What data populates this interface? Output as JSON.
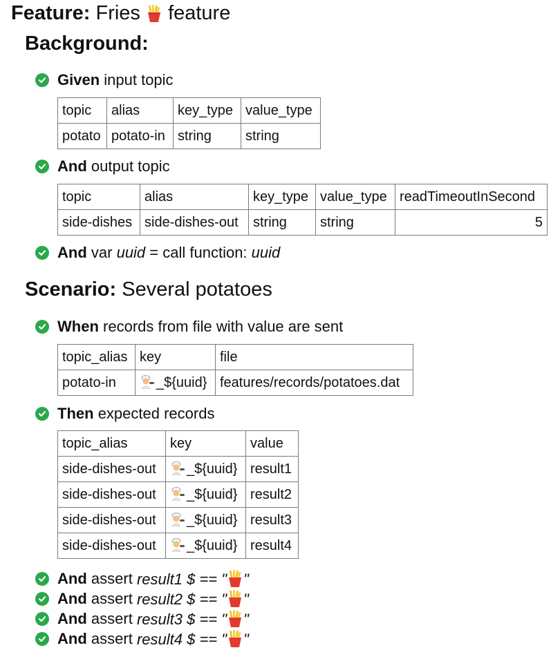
{
  "feature": {
    "keyword": "Feature:",
    "name_before": "Fries",
    "name_after": "feature"
  },
  "background": {
    "keyword": "Background:",
    "steps": [
      {
        "keyword": "Given",
        "text": "input topic",
        "table": {
          "headers": [
            "topic",
            "alias",
            "key_type",
            "value_type"
          ],
          "rows": [
            [
              "potato",
              "potato-in",
              "string",
              "string"
            ]
          ]
        }
      },
      {
        "keyword": "And",
        "text": "output topic",
        "table": {
          "headers": [
            "topic",
            "alias",
            "key_type",
            "value_type",
            "readTimeoutInSecond"
          ],
          "rows": [
            [
              "side-dishes",
              "side-dishes-out",
              "string",
              "string",
              "5"
            ]
          ]
        }
      },
      {
        "keyword": "And",
        "pre": "var",
        "var": "uuid",
        "mid": "= call function:",
        "fn": "uuid"
      }
    ]
  },
  "scenario": {
    "keyword": "Scenario:",
    "name": "Several potatoes",
    "steps": [
      {
        "keyword": "When",
        "text": "records from file with value are sent",
        "table": {
          "headers": [
            "topic_alias",
            "key",
            "file"
          ],
          "rows": [
            [
              "potato-in",
              "_${uuid}",
              "features/records/potatoes.dat"
            ]
          ]
        }
      },
      {
        "keyword": "Then",
        "text": "expected records",
        "table": {
          "headers": [
            "topic_alias",
            "key",
            "value"
          ],
          "rows": [
            [
              "side-dishes-out",
              "_${uuid}",
              "result1"
            ],
            [
              "side-dishes-out",
              "_${uuid}",
              "result2"
            ],
            [
              "side-dishes-out",
              "_${uuid}",
              "result3"
            ],
            [
              "side-dishes-out",
              "_${uuid}",
              "result4"
            ]
          ]
        }
      }
    ],
    "asserts": [
      {
        "keyword": "And",
        "pre": "assert",
        "name": "result1",
        "expr": "$ == \"",
        "close": "\""
      },
      {
        "keyword": "And",
        "pre": "assert",
        "name": "result2",
        "expr": "$ == \"",
        "close": "\""
      },
      {
        "keyword": "And",
        "pre": "assert",
        "name": "result3",
        "expr": "$ == \"",
        "close": "\""
      },
      {
        "keyword": "And",
        "pre": "assert",
        "name": "result4",
        "expr": "$ == \"",
        "close": "\""
      }
    ]
  },
  "icons": {
    "status": "check-circle-icon",
    "fries": "fries-icon",
    "cook": "cook-icon"
  },
  "colors": {
    "passed": "#2aa84a",
    "border": "#7a7a7a"
  }
}
